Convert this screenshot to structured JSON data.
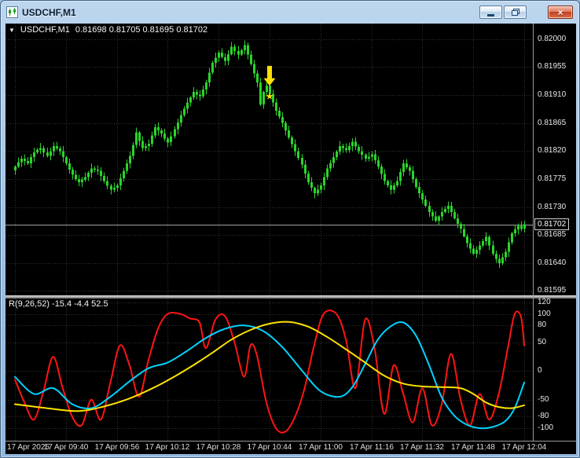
{
  "window": {
    "title": "USDCHF,M1",
    "controls": {
      "close": "×"
    }
  },
  "chart": {
    "header": {
      "toggle": "▼",
      "symbol": "USDCHF,M1",
      "quotes": "0.81698 0.81705 0.81695 0.81702"
    }
  },
  "indicator": {
    "label": "R(9,26,52) -15.4 -4.4 52.5"
  },
  "colors": {
    "background": "#000000",
    "grid": "#343434",
    "bull": "#2bd42b",
    "bid_line": "#a0a0a0",
    "axis_text": "#e9e9e9",
    "annotation": "#ffe100",
    "ind_fast": "#ff1414",
    "ind_medium": "#00d2ff",
    "ind_slow": "#ffe100"
  },
  "chart_data": {
    "type": "candlestick",
    "symbol": "USDCHF",
    "timeframe": "M1",
    "ohlc_display": {
      "open": "0.81698",
      "high": "0.81705",
      "low": "0.81695",
      "close": "0.81702"
    },
    "bid_price": 0.81702,
    "bid_display": "0.81702",
    "price_view_range": [
      0.81588,
      0.82025
    ],
    "price_axis_ticks": [
      "0.82000",
      "0.81955",
      "0.81910",
      "0.81865",
      "0.81820",
      "0.81775",
      "0.81730",
      "0.81685",
      "0.81640",
      "0.81595"
    ],
    "x_axis_ticks": [
      {
        "label": "17 Apr 2025",
        "index": 0
      },
      {
        "label": "17 Apr 09:40",
        "index": 16
      },
      {
        "label": "17 Apr 09:56",
        "index": 32
      },
      {
        "label": "17 Apr 10:12",
        "index": 48
      },
      {
        "label": "17 Apr 10:28",
        "index": 64
      },
      {
        "label": "17 Apr 10:44",
        "index": 80
      },
      {
        "label": "17 Apr 11:00",
        "index": 96
      },
      {
        "label": "17 Apr 11:16",
        "index": 112
      },
      {
        "label": "17 Apr 11:32",
        "index": 128
      },
      {
        "label": "17 Apr 11:48",
        "index": 144
      },
      {
        "label": "17 Apr 12:04",
        "index": 160
      }
    ],
    "closes": [
      0.81795,
      0.81802,
      0.81808,
      0.81804,
      0.818,
      0.8181,
      0.81818,
      0.81822,
      0.81825,
      0.81818,
      0.81812,
      0.8182,
      0.81828,
      0.81824,
      0.8182,
      0.8181,
      0.818,
      0.8179,
      0.81782,
      0.81775,
      0.8177,
      0.81774,
      0.81778,
      0.81785,
      0.81792,
      0.8179,
      0.81788,
      0.8178,
      0.81772,
      0.81764,
      0.81758,
      0.81761,
      0.81765,
      0.81776,
      0.81788,
      0.818,
      0.81812,
      0.8183,
      0.8185,
      0.81836,
      0.81825,
      0.81828,
      0.81832,
      0.81845,
      0.81858,
      0.81853,
      0.81848,
      0.8184,
      0.81834,
      0.81844,
      0.81855,
      0.81866,
      0.81878,
      0.81888,
      0.81898,
      0.81906,
      0.81915,
      0.81911,
      0.81908,
      0.81919,
      0.8193,
      0.81946,
      0.81962,
      0.8197,
      0.81978,
      0.81971,
      0.81965,
      0.81976,
      0.81988,
      0.81981,
      0.81975,
      0.81982,
      0.8199,
      0.81975,
      0.8196,
      0.81945,
      0.8193,
      0.81895,
      0.81915,
      0.81925,
      0.81912,
      0.81898,
      0.81885,
      0.81875,
      0.81865,
      0.81853,
      0.81842,
      0.81831,
      0.8182,
      0.81809,
      0.81798,
      0.81784,
      0.8177,
      0.81761,
      0.81752,
      0.81758,
      0.81765,
      0.81778,
      0.81792,
      0.81801,
      0.8181,
      0.81819,
      0.81828,
      0.81825,
      0.81822,
      0.81828,
      0.81835,
      0.81827,
      0.8182,
      0.81814,
      0.81808,
      0.81811,
      0.81815,
      0.81805,
      0.81795,
      0.81783,
      0.81772,
      0.81765,
      0.81758,
      0.81765,
      0.81772,
      0.81786,
      0.818,
      0.81794,
      0.81788,
      0.81775,
      0.81762,
      0.81752,
      0.81742,
      0.81732,
      0.81722,
      0.81715,
      0.81708,
      0.81715,
      0.81722,
      0.81727,
      0.81732,
      0.81722,
      0.81712,
      0.81703,
      0.81695,
      0.81683,
      0.81672,
      0.81663,
      0.81655,
      0.81661,
      0.81668,
      0.81675,
      0.81682,
      0.81668,
      0.81655,
      0.81647,
      0.8164,
      0.81649,
      0.81658,
      0.81673,
      0.81688,
      0.81694,
      0.817,
      0.81695,
      0.81702
    ],
    "annotations": [
      {
        "type": "arrow-down",
        "color": "#ffe100",
        "index": 80,
        "price_top": 0.81957,
        "price_mid": 0.81937,
        "price_tip": 0.81925
      },
      {
        "type": "star",
        "color": "#ffe100",
        "index": 80,
        "price": 0.81908,
        "glyph": "★"
      }
    ],
    "indicator": {
      "title": "R(9,26,52) -15.4 -4.4 52.5",
      "indicator_view_range": [
        -122,
        127
      ],
      "axis_ticks": [
        "120",
        "100",
        "80",
        "50",
        "0",
        "-50",
        "-80",
        "-100"
      ],
      "series": [
        {
          "name": "fast",
          "color": "#ff1414",
          "points": [
            [
              0,
              -15
            ],
            [
              3,
              -55
            ],
            [
              6,
              -85
            ],
            [
              9,
              -35
            ],
            [
              12,
              25
            ],
            [
              15,
              -30
            ],
            [
              18,
              -80
            ],
            [
              21,
              -95
            ],
            [
              24,
              -50
            ],
            [
              27,
              -85
            ],
            [
              30,
              -20
            ],
            [
              33,
              45
            ],
            [
              36,
              10
            ],
            [
              39,
              -45
            ],
            [
              42,
              20
            ],
            [
              45,
              75
            ],
            [
              48,
              100
            ],
            [
              52,
              100
            ],
            [
              55,
              92
            ],
            [
              58,
              85
            ],
            [
              60,
              40
            ],
            [
              63,
              90
            ],
            [
              66,
              96
            ],
            [
              69,
              50
            ],
            [
              72,
              -10
            ],
            [
              74,
              45
            ],
            [
              76,
              28
            ],
            [
              79,
              -55
            ],
            [
              82,
              -100
            ],
            [
              85,
              -106
            ],
            [
              88,
              -80
            ],
            [
              91,
              -30
            ],
            [
              94,
              45
            ],
            [
              97,
              100
            ],
            [
              101,
              100
            ],
            [
              104,
              55
            ],
            [
              107,
              -30
            ],
            [
              110,
              90
            ],
            [
              113,
              40
            ],
            [
              116,
              -75
            ],
            [
              119,
              10
            ],
            [
              122,
              -40
            ],
            [
              125,
              -90
            ],
            [
              128,
              -30
            ],
            [
              131,
              -95
            ],
            [
              134,
              -60
            ],
            [
              137,
              30
            ],
            [
              140,
              -50
            ],
            [
              143,
              -95
            ],
            [
              146,
              -40
            ],
            [
              149,
              -85
            ],
            [
              152,
              -40
            ],
            [
              155,
              45
            ],
            [
              157,
              100
            ],
            [
              159,
              95
            ],
            [
              160,
              45
            ]
          ]
        },
        {
          "name": "medium",
          "color": "#00d2ff",
          "points": [
            [
              0,
              -10
            ],
            [
              6,
              -40
            ],
            [
              12,
              -30
            ],
            [
              18,
              -58
            ],
            [
              24,
              -65
            ],
            [
              30,
              -45
            ],
            [
              36,
              -18
            ],
            [
              42,
              5
            ],
            [
              48,
              15
            ],
            [
              54,
              35
            ],
            [
              60,
              58
            ],
            [
              66,
              74
            ],
            [
              72,
              80
            ],
            [
              78,
              70
            ],
            [
              84,
              42
            ],
            [
              90,
              2
            ],
            [
              96,
              -35
            ],
            [
              102,
              -45
            ],
            [
              106,
              -28
            ],
            [
              110,
              12
            ],
            [
              114,
              55
            ],
            [
              118,
              78
            ],
            [
              122,
              85
            ],
            [
              126,
              62
            ],
            [
              130,
              12
            ],
            [
              134,
              -45
            ],
            [
              138,
              -78
            ],
            [
              142,
              -94
            ],
            [
              146,
              -100
            ],
            [
              150,
              -98
            ],
            [
              154,
              -88
            ],
            [
              157,
              -65
            ],
            [
              160,
              -20
            ]
          ]
        },
        {
          "name": "slow",
          "color": "#ffe100",
          "points": [
            [
              0,
              -58
            ],
            [
              10,
              -65
            ],
            [
              20,
              -70
            ],
            [
              28,
              -62
            ],
            [
              36,
              -48
            ],
            [
              44,
              -28
            ],
            [
              50,
              -10
            ],
            [
              56,
              10
            ],
            [
              62,
              32
            ],
            [
              68,
              55
            ],
            [
              74,
              72
            ],
            [
              80,
              83
            ],
            [
              86,
              86
            ],
            [
              92,
              78
            ],
            [
              98,
              60
            ],
            [
              104,
              38
            ],
            [
              110,
              15
            ],
            [
              116,
              -8
            ],
            [
              122,
              -22
            ],
            [
              128,
              -27
            ],
            [
              134,
              -28
            ],
            [
              140,
              -30
            ],
            [
              144,
              -40
            ],
            [
              148,
              -55
            ],
            [
              152,
              -63
            ],
            [
              156,
              -65
            ],
            [
              160,
              -60
            ]
          ]
        }
      ]
    }
  }
}
